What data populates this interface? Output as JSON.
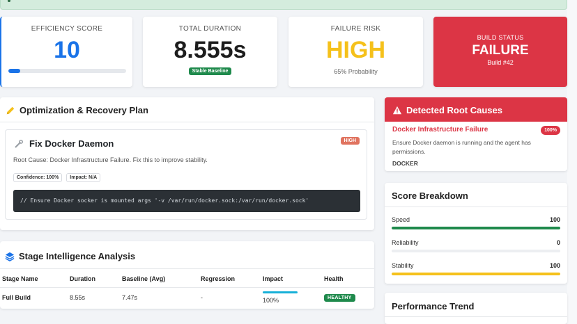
{
  "kpis": {
    "efficiency": {
      "label": "EFFICIENCY SCORE",
      "value": "10",
      "progress_pct": 10,
      "color": "#1a73e8"
    },
    "duration": {
      "label": "TOTAL DURATION",
      "value": "8.555s",
      "badge": "Stable Baseline"
    },
    "risk": {
      "label": "FAILURE RISK",
      "value": "HIGH",
      "sub": "65% Probability",
      "color": "#f5c11b"
    },
    "build": {
      "label": "BUILD STATUS",
      "value": "FAILURE",
      "sub": "Build #42",
      "color": "#dc3545"
    }
  },
  "plan": {
    "title": "Optimization & Recovery Plan",
    "icon": "pencil-icon",
    "fix": {
      "title": "Fix Docker Daemon",
      "icon": "wrench-icon",
      "priority": "HIGH",
      "description": "Root Cause: Docker Infrastructure Failure. Fix this to improve stability.",
      "confidence": "Confidence: 100%",
      "impact": "Impact: N/A",
      "code": "// Ensure Docker socker is mounted args '-v /var/run/docker.sock:/var/run/docker.sock'"
    }
  },
  "stage": {
    "title": "Stage Intelligence Analysis",
    "icon": "layers-icon",
    "columns": [
      "Stage Name",
      "Duration",
      "Baseline (Avg)",
      "Regression",
      "Impact",
      "Health"
    ],
    "rows": [
      {
        "name": "Full Build",
        "duration": "8.55s",
        "baseline": "7.47s",
        "regression": "-",
        "impact": "100%",
        "impact_pct": 100,
        "health": "HEALTHY"
      }
    ]
  },
  "root_causes": {
    "title": "Detected Root Causes",
    "icon": "warning-icon",
    "items": [
      {
        "title": "Docker Infrastructure Failure",
        "badge": "100%",
        "description": "Ensure Docker daemon is running and the agent has permissions.",
        "tag": "DOCKER"
      }
    ]
  },
  "score": {
    "title": "Score Breakdown",
    "metrics": [
      {
        "label": "Speed",
        "value": "100",
        "pct": 100,
        "color": "#1f8a4c"
      },
      {
        "label": "Reliability",
        "value": "0",
        "pct": 0,
        "color": "#dc3545"
      },
      {
        "label": "Stability",
        "value": "100",
        "pct": 100,
        "color": "#f5c11b"
      }
    ]
  },
  "performance": {
    "title": "Performance Trend"
  }
}
